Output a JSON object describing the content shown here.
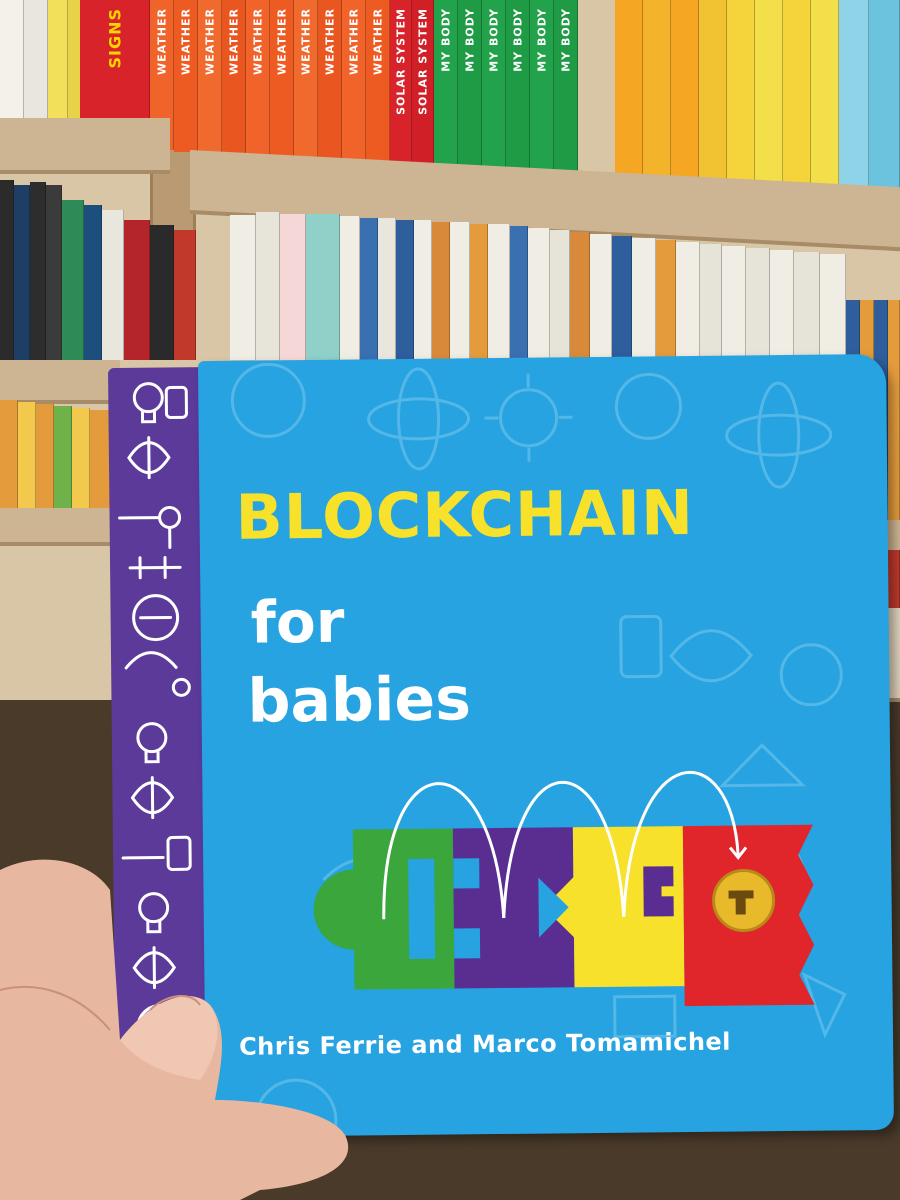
{
  "shelf": {
    "top_row_spines": [
      {
        "label": "SIGNS",
        "color": "#d8232a"
      },
      {
        "label": "WEATHER",
        "color": "#f0632a"
      },
      {
        "label": "WEATHER",
        "color": "#ee5b22"
      },
      {
        "label": "WEATHER",
        "color": "#f06a2e"
      },
      {
        "label": "WEATHER",
        "color": "#e9561f"
      },
      {
        "label": "WEATHER",
        "color": "#f0632a"
      },
      {
        "label": "WEATHER",
        "color": "#ee5b22"
      },
      {
        "label": "WEATHER",
        "color": "#f06a2e"
      },
      {
        "label": "WEATHER",
        "color": "#e9561f"
      },
      {
        "label": "WEATHER",
        "color": "#f0632a"
      },
      {
        "label": "WEATHER",
        "color": "#ee5b22"
      },
      {
        "label": "SOLAR SYSTEM",
        "color": "#d8232a"
      },
      {
        "label": "SOLAR SYSTEM",
        "color": "#d11f27"
      },
      {
        "label": "MY BODY",
        "color": "#22a24a"
      },
      {
        "label": "MY BODY",
        "color": "#1f9a45"
      },
      {
        "label": "MY BODY",
        "color": "#22a24a"
      },
      {
        "label": "MY BODY",
        "color": "#1f9a45"
      },
      {
        "label": "MY BODY",
        "color": "#22a24a"
      },
      {
        "label": "MY BODY",
        "color": "#1f9a45"
      }
    ]
  },
  "book": {
    "title_line1": "BLOCKCHAIN",
    "title_line2": "for",
    "title_line3": "babies",
    "authors": "Chris Ferrie and Marco Tomamichel"
  },
  "colors": {
    "cover_blue": "#26a3e0",
    "title_yellow": "#f7e12a",
    "spine_purple": "#5b3a9a",
    "block_green": "#3aa63c",
    "block_purple": "#5a2d91",
    "block_yellow": "#f7e12a",
    "block_red": "#e0262b",
    "coin_gold": "#e9b92c"
  }
}
